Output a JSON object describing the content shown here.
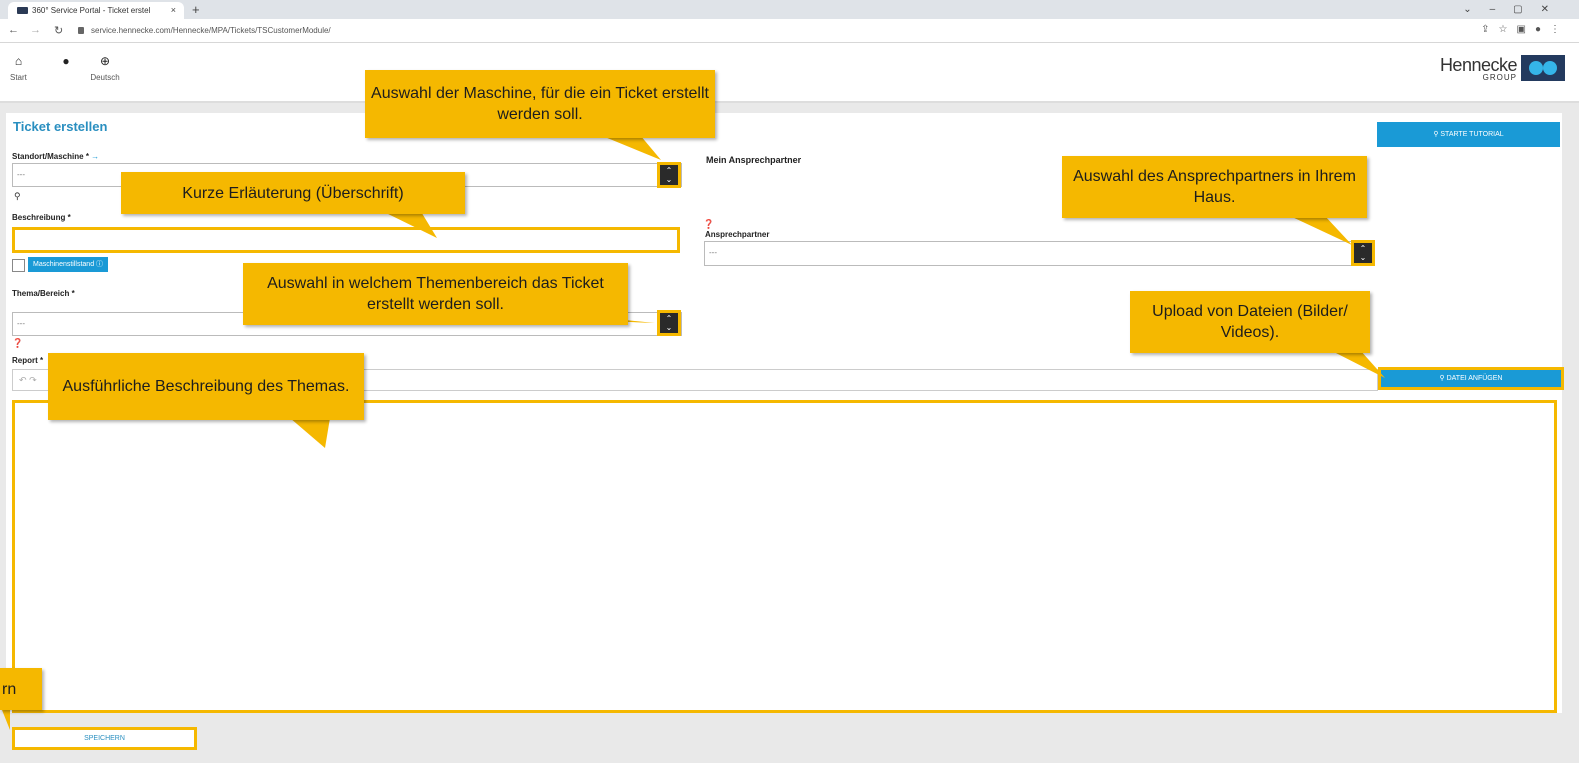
{
  "browser": {
    "tab_title": "360° Service Portal - Ticket erstel",
    "tab_close": "×",
    "new_tab": "+",
    "url": "service.hennecke.com/Hennecke/MPA/Tickets/TSCustomerModule/"
  },
  "header": {
    "start_label": "Start",
    "language_label": "Deutsch",
    "brand_name": "Hennecke",
    "brand_sub": "GROUP"
  },
  "form": {
    "title": "Ticket erstellen",
    "tutorial_button": "STARTE TUTORIAL",
    "standort_label": "Standort/Maschine",
    "standort_required": "*",
    "standort_value": "---",
    "ansprechpartner_heading": "Mein Ansprechpartner",
    "beschreibung_label": "Beschreibung",
    "beschreibung_required": "*",
    "beschreibung_value": "",
    "maschinenstillstand_label": "Maschinenstillstand",
    "ansprechpartner_label": "Ansprechpartner",
    "ansprechpartner_value": "---",
    "thema_label": "Thema/Bereich",
    "thema_required": "*",
    "thema_value": "---",
    "report_label": "Report",
    "report_required": "*",
    "attach_button": "DATEI ANFÜGEN",
    "save_button": "SPEICHERN"
  },
  "annotations": {
    "maschine": "Auswahl der Maschine, für die ein Ticket erstellt werden soll.",
    "ueberschrift": "Kurze Erläuterung (Überschrift)",
    "ansprechpartner": "Auswahl des Ansprechpartners in Ihrem Haus.",
    "thema": "Auswahl in welchem Themenbereich das Ticket erstellt werden soll.",
    "upload": "Upload von Dateien (Bilder/ Videos).",
    "report": "Ausführliche Beschreibung des Themas.",
    "speichern_fragment": "rn"
  },
  "colors": {
    "accent_blue": "#1a9ad6",
    "highlight_yellow": "#f5b800",
    "title_blue": "#2a8fc0"
  }
}
